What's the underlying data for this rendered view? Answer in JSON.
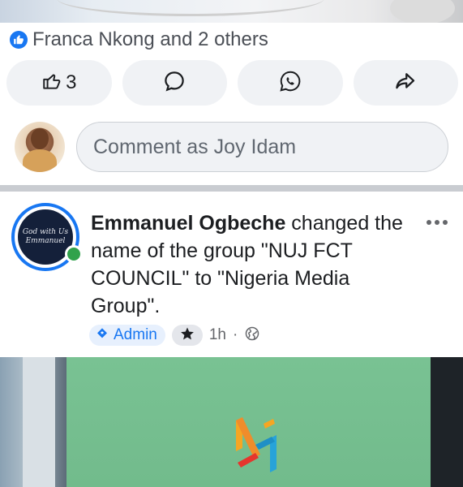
{
  "reactions": {
    "text": "Franca Nkong and 2 others",
    "icon": "like-icon",
    "accent": "#1877f2"
  },
  "actions": {
    "like_count": "3",
    "buttons": [
      {
        "icon": "like-icon"
      },
      {
        "icon": "comment-icon"
      },
      {
        "icon": "whatsapp-icon"
      },
      {
        "icon": "share-icon"
      }
    ]
  },
  "comment": {
    "placeholder": "Comment as Joy Idam"
  },
  "post": {
    "author": "Emmanuel Ogbeche",
    "action_text": " changed the name of the group \"NUJ FCT COUNCIL\" to \"Nigeria Media Group\".",
    "avatar_text": "God with Us Emmanuel",
    "badge": "Admin",
    "time": "1h",
    "separator": "·",
    "privacy_icon": "globe-icon",
    "online_color": "#31a24c"
  }
}
